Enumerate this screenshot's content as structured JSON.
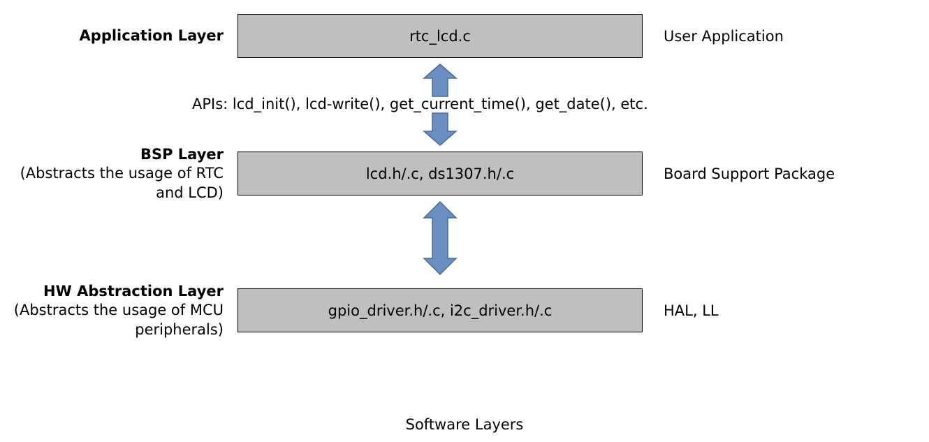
{
  "layers": [
    {
      "left_title": "Application Layer",
      "left_subtitle": "",
      "box_text": "rtc_lcd.c",
      "right_text": "User Application"
    },
    {
      "left_title": "BSP Layer",
      "left_subtitle": "(Abstracts the usage of RTC and LCD)",
      "box_text": "lcd.h/.c, ds1307.h/.c",
      "right_text": "Board Support Package"
    },
    {
      "left_title": "HW Abstraction Layer",
      "left_subtitle": "(Abstracts the usage of MCU peripherals)",
      "box_text": "gpio_driver.h/.c, i2c_driver.h/.c",
      "right_text": "HAL, LL"
    }
  ],
  "api_text": "APIs: lcd_init(), lcd-write(), get_current_time(), get_date(), etc.",
  "caption": "Software Layers",
  "arrow_color": "#6a8ebf",
  "arrow_stroke": "#4a6a99",
  "box_fill": "#bfbfbf"
}
